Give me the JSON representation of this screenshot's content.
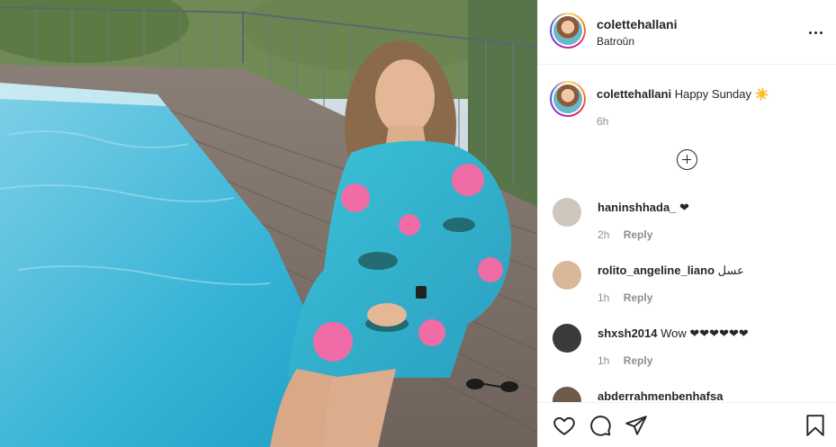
{
  "post": {
    "username": "colettehallani",
    "location": "Batroûn"
  },
  "caption": {
    "username": "colettehallani",
    "text": "Happy Sunday ☀️",
    "time": "6h"
  },
  "comments": [
    {
      "username": "haninshhada_",
      "text": "❤",
      "time": "2h",
      "reply_label": "Reply",
      "avatar_color": "#cfc7bd"
    },
    {
      "username": "rolito_angeline_liano",
      "text": "عسل",
      "time": "1h",
      "reply_label": "Reply",
      "avatar_color": "#d9b89a"
    },
    {
      "username": "shxsh2014",
      "text": "Wow ❤❤❤❤❤❤",
      "time": "1h",
      "reply_label": "Reply",
      "avatar_color": "#3a3a3a"
    },
    {
      "username": "abderrahmenbenhafsa",
      "text": "",
      "time": "",
      "reply_label": "",
      "avatar_color": "#6d5a48"
    }
  ],
  "icons": {
    "like": "heart-icon",
    "comment": "comment-icon",
    "share": "share-icon",
    "save": "bookmark-icon",
    "more": "more-options-icon",
    "load_more": "plus-circle-icon"
  },
  "colors": {
    "text": "#262626",
    "muted": "#8e8e8e",
    "divider": "#efefef"
  }
}
